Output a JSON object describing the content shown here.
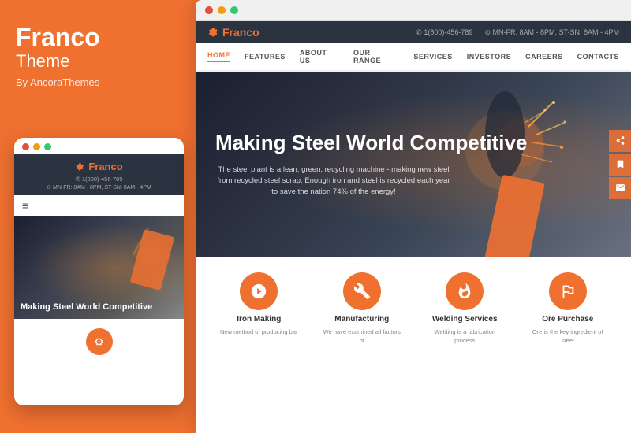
{
  "left": {
    "brand": "Franco",
    "theme_label": "Theme",
    "by_label": "By AncoraThemes"
  },
  "mobile": {
    "dots": [
      "#e74c3c",
      "#f39c12",
      "#2ecc71"
    ],
    "logo": "Franco",
    "phone": "✆ 1(800)-456-789",
    "hours": "⊙ MN-FR: 8AM - 8PM, ST-SN: 8AM - 4PM",
    "menu_icon": "≡",
    "hero_title": "Making Steel World Competitive"
  },
  "browser": {
    "dots": [
      "#e74c3c",
      "#f39c12",
      "#2ecc71"
    ],
    "header": {
      "logo": "Franco",
      "phone": "✆ 1(800)-456-789",
      "hours": "⊙ MN-FR: 8AM - 8PM, ST-SN: 8AM - 4PM"
    },
    "nav": {
      "items": [
        "HOME",
        "FEATURES",
        "ABOUT US",
        "OUR RANGE",
        "SERVICES",
        "INVESTORS",
        "CAREERS",
        "CONTACTS"
      ],
      "active_index": 0
    },
    "hero": {
      "title": "Making Steel World Competitive",
      "desc": "The steel plant is a lean, green, recycling machine - making new steel from recycled steel scrap. Enough iron and steel is recycled each year to save the nation 74% of the energy!"
    },
    "features": [
      {
        "label": "Iron Making",
        "desc": "New method of producing bar",
        "icon": "⚙"
      },
      {
        "label": "Manufacturing",
        "desc": "We have examined all factors of",
        "icon": "🔧"
      },
      {
        "label": "Welding Services",
        "desc": "Welding is a fabrication process",
        "icon": "⚙"
      },
      {
        "label": "Ore Purchase",
        "desc": "Ore is the key ingredient of steel",
        "icon": "🏔"
      }
    ]
  }
}
